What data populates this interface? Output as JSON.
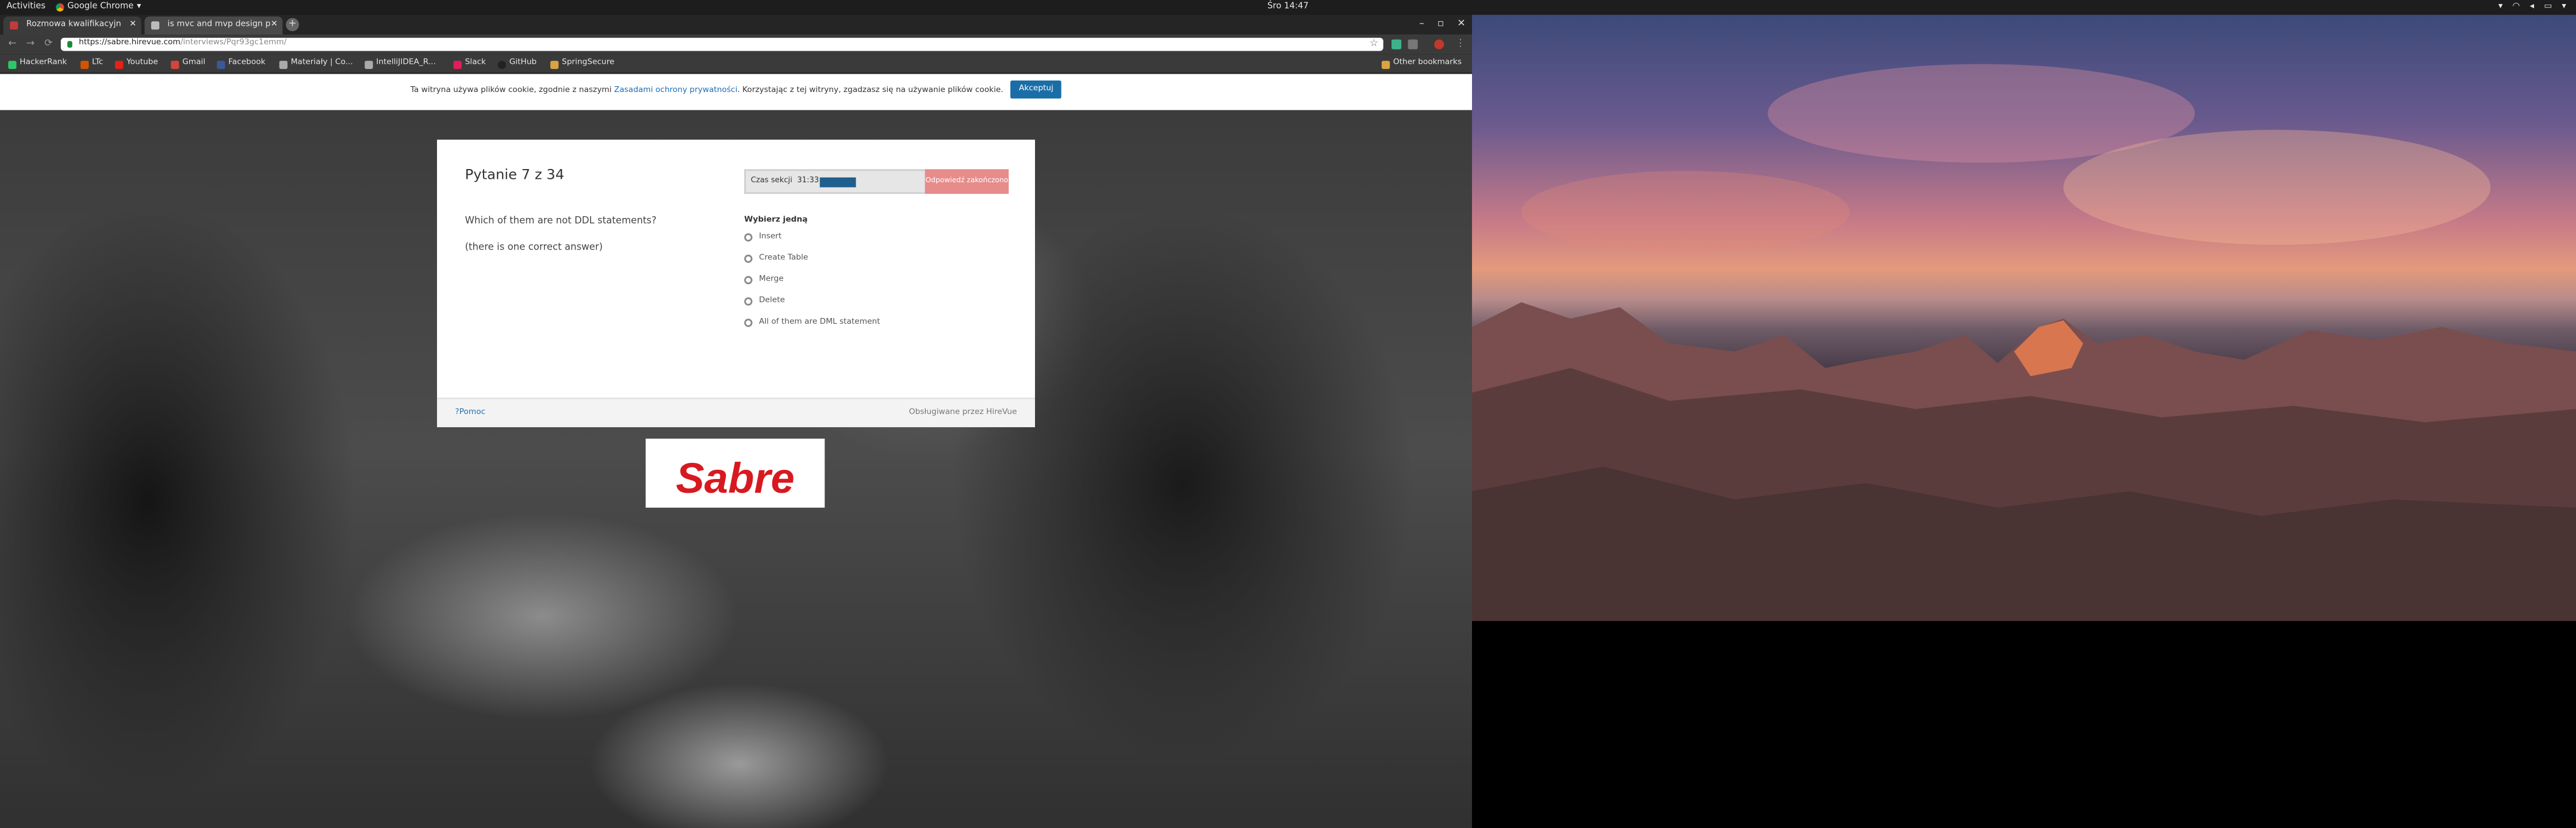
{
  "topbar": {
    "activities": "Activities",
    "app_name": "Google Chrome",
    "clock": "Śro 14:47"
  },
  "browser": {
    "tabs": [
      {
        "label": "Rozmowa kwalifikacyjn"
      },
      {
        "label": "is mvc and mvp design p"
      }
    ],
    "url_host": "https://sabre.hirevue.com",
    "url_path": "/interviews/Pqr93gc1emm/",
    "bookmarks": [
      {
        "label": "HackerRank",
        "color": "#2ec866"
      },
      {
        "label": "LTc",
        "color": "#d35400"
      },
      {
        "label": "Youtube",
        "color": "#e62117"
      },
      {
        "label": "Gmail",
        "color": "#d44638"
      },
      {
        "label": "Facebook",
        "color": "#3b5998"
      },
      {
        "label": "Materiały | Co...",
        "color": "#aaaaaa"
      },
      {
        "label": "IntelliJIDEA_R...",
        "color": "#aaaaaa"
      },
      {
        "label": "Slack",
        "color": "#e01e5a"
      },
      {
        "label": "GitHub",
        "color": "#333333"
      },
      {
        "label": "SpringSecure",
        "color": "#d9a441"
      }
    ],
    "other_bookmarks": "Other bookmarks"
  },
  "cookie_banner": {
    "text_before": "Ta witryna używa plików cookie, zgodnie z naszymi",
    "link": "Zasadami ochrony prywatności",
    "text_after": ". Korzystając z tej witryny, zgadzasz się na używanie plików cookie.",
    "accept_label": "Akceptuj"
  },
  "question": {
    "title": "Pytanie 7 z 34",
    "timer_label": "Czas sekcji",
    "timer_value": "31:33",
    "timer_progress": 0.25,
    "timer_overlay": "Odpowiedź zakończono",
    "text": "Which of them are not DDL statements?",
    "hint": "(there is one correct answer)",
    "choose_label": "Wybierz jedną",
    "options": [
      "Insert",
      "Create Table",
      "Merge",
      "Delete",
      "All of them are DML statement"
    ]
  },
  "footer": {
    "help": "Pomoc",
    "powered": "Obsługiwane przez HireVue"
  },
  "logo": {
    "text": "Sabre"
  },
  "colors": {
    "accent": "#1a6ea8",
    "sabre_red": "#d71920",
    "timer_bar": "#1e5f8e"
  }
}
